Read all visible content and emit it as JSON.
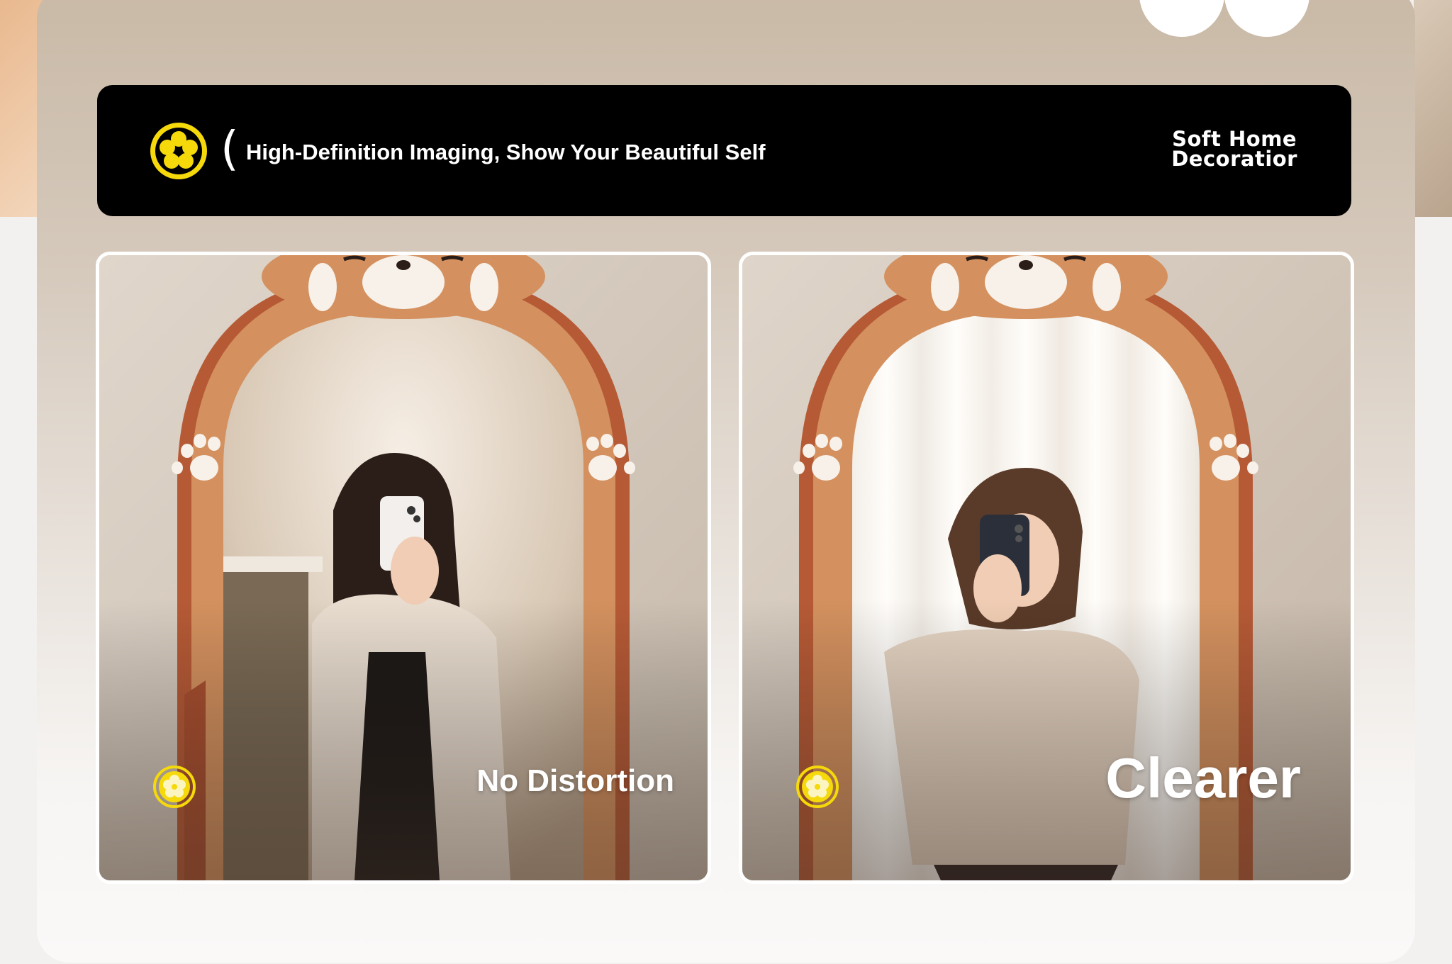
{
  "banner": {
    "tagline": "High-Definition Imaging, Show Your Beautiful Self",
    "paren": "(",
    "brand_line1": "Soft Home",
    "brand_line2": "Decoratior"
  },
  "panels": [
    {
      "caption": "No Distortion"
    },
    {
      "caption": "Clearer"
    }
  ],
  "colors": {
    "accent_yellow": "#f5d90a",
    "mirror_frame": "#d4915f",
    "mirror_frame_dark": "#b65a36",
    "banner_bg": "#000000"
  }
}
